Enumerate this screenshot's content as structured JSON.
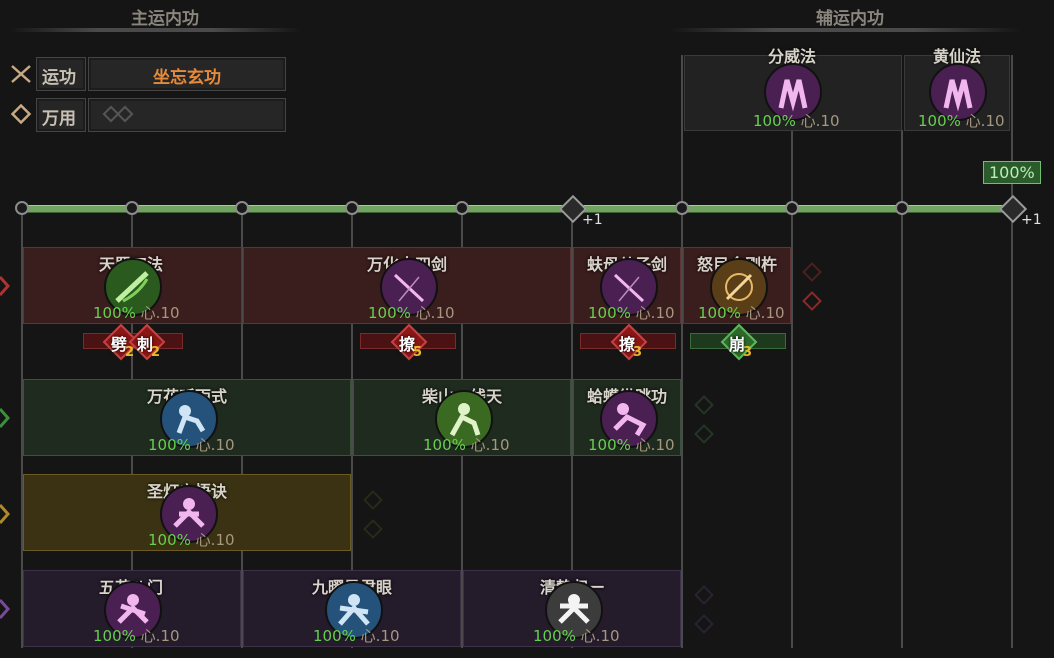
{
  "main_header": "主运内功",
  "aux_header": "辅运内功",
  "yun_label": "运功",
  "yun_value": "坐忘玄功",
  "wan_label": "万用",
  "track_badge": "100%",
  "track_plus_mid": "+1",
  "track_plus_end": "+1",
  "aux_skills": [
    {
      "name": "分威法",
      "pct": "100%",
      "xin": "心.10"
    },
    {
      "name": "黄仙法",
      "pct": "100%",
      "xin": "心.10"
    }
  ],
  "rows": {
    "red": [
      {
        "name": "天罡刀法",
        "pct": "100%",
        "xin": "心.10"
      },
      {
        "name": "万化十四剑",
        "pct": "100%",
        "xin": "心.10"
      },
      {
        "name": "蚨母从子剑",
        "pct": "100%",
        "xin": "心.10"
      },
      {
        "name": "怒目金刚杵",
        "pct": "100%",
        "xin": "心.10"
      }
    ],
    "green": [
      {
        "name": "万花听雨式",
        "pct": "100%",
        "xin": "心.10"
      },
      {
        "name": "柴山一线天",
        "pct": "100%",
        "xin": "心.10"
      },
      {
        "name": "蛤蟆纵跳功",
        "pct": "100%",
        "xin": "心.10"
      }
    ],
    "gold": [
      {
        "name": "圣灯启悟诀",
        "pct": "100%",
        "xin": "心.10"
      }
    ],
    "purple": [
      {
        "name": "五花八门",
        "pct": "100%",
        "xin": "心.10"
      },
      {
        "name": "九曜星君眼",
        "pct": "100%",
        "xin": "心.10"
      },
      {
        "name": "清静归一",
        "pct": "100%",
        "xin": "心.10"
      }
    ]
  },
  "tags": [
    {
      "text": "劈",
      "num": "2"
    },
    {
      "text": "刺",
      "num": "2"
    },
    {
      "text": "撩",
      "num": "5"
    },
    {
      "text": "撩",
      "num": "3"
    },
    {
      "text": "崩",
      "num": "3"
    }
  ],
  "colors": {
    "track": "#6fa35f",
    "pct": "#66d04f",
    "red_row": "#3a1d1d",
    "green_row": "#1f2b1f",
    "gold_row": "#3a3212",
    "purple_row": "#241b2b"
  }
}
